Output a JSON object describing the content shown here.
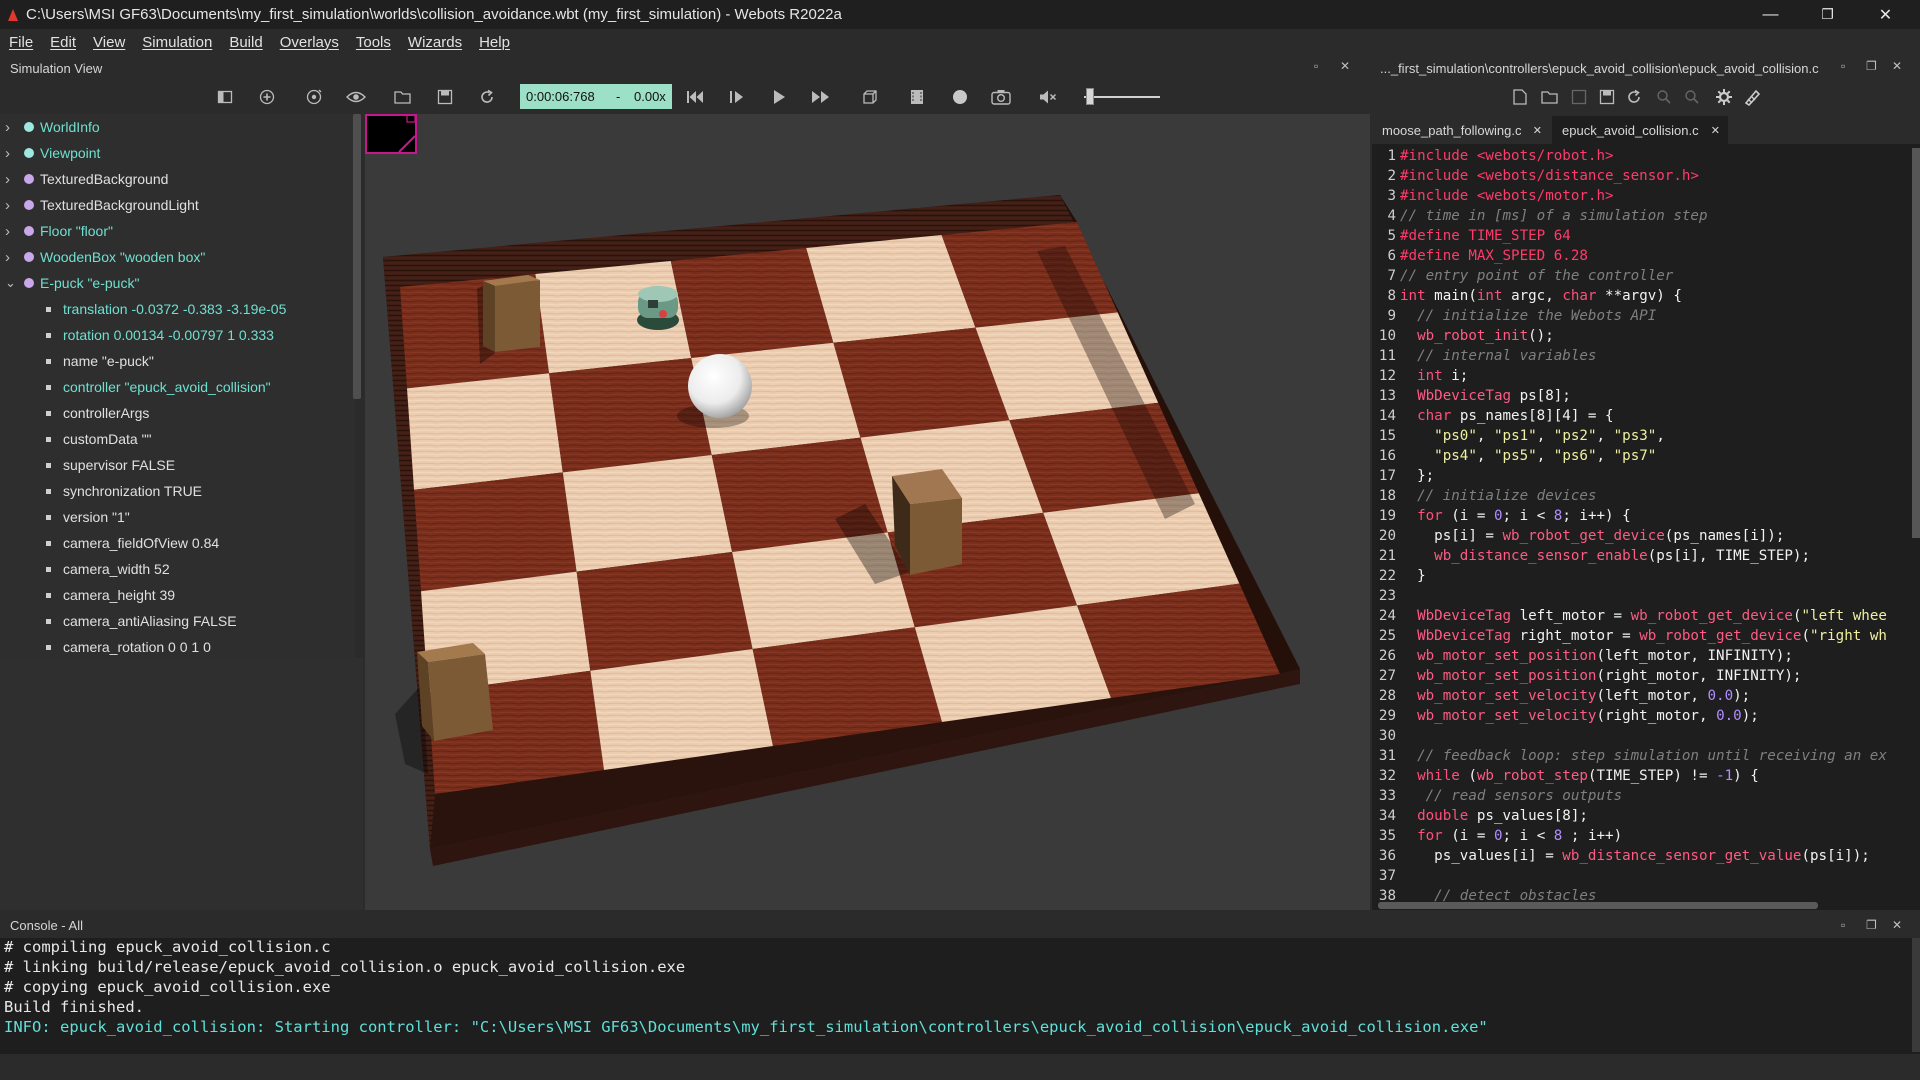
{
  "window": {
    "title": "C:\\Users\\MSI GF63\\Documents\\my_first_simulation\\worlds\\collision_avoidance.wbt (my_first_simulation) - Webots R2022a",
    "min": "—",
    "max": "❐",
    "close": "✕"
  },
  "menu": [
    "File",
    "Edit",
    "View",
    "Simulation",
    "Build",
    "Overlays",
    "Tools",
    "Wizards",
    "Help"
  ],
  "simview": {
    "title": "Simulation View",
    "float": "▫",
    "close": "✕"
  },
  "toolbar": {
    "time": "0:00:06:768",
    "dash": "-",
    "speed": "0.00x"
  },
  "tree": [
    {
      "label": "WorldInfo",
      "color": "#6fe0d0",
      "dot": "#9ee8e0",
      "level": 0,
      "open": false
    },
    {
      "label": "Viewpoint",
      "color": "#6fe0d0",
      "dot": "#9ee8e0",
      "level": 0,
      "open": false
    },
    {
      "label": "TexturedBackground",
      "color": "#e0e0e0",
      "dot": "#c8a8e8",
      "level": 0,
      "open": false
    },
    {
      "label": "TexturedBackgroundLight",
      "color": "#e0e0e0",
      "dot": "#c8a8e8",
      "level": 0,
      "open": false
    },
    {
      "label": "Floor \"floor\"",
      "color": "#6fe0d0",
      "dot": "#c8a8e8",
      "level": 0,
      "open": false
    },
    {
      "label": "WoodenBox \"wooden box\"",
      "color": "#6fe0d0",
      "dot": "#c8a8e8",
      "level": 0,
      "open": false
    },
    {
      "label": "E-puck \"e-puck\"",
      "color": "#6fe0d0",
      "dot": "#c8a8e8",
      "level": 0,
      "open": true
    },
    {
      "label": "translation -0.0372 -0.383 -3.19e-05",
      "color": "#6fe0d0",
      "level": 1
    },
    {
      "label": "rotation 0.00134 -0.00797 1 0.333",
      "color": "#6fe0d0",
      "level": 1
    },
    {
      "label": "name \"e-puck\"",
      "color": "#e0e0e0",
      "level": 1
    },
    {
      "label": "controller \"epuck_avoid_collision\"",
      "color": "#6fe0d0",
      "level": 1
    },
    {
      "label": "controllerArgs",
      "color": "#e0e0e0",
      "level": 1
    },
    {
      "label": "customData \"\"",
      "color": "#e0e0e0",
      "level": 1
    },
    {
      "label": "supervisor FALSE",
      "color": "#e0e0e0",
      "level": 1
    },
    {
      "label": "synchronization TRUE",
      "color": "#e0e0e0",
      "level": 1
    },
    {
      "label": "version \"1\"",
      "color": "#e0e0e0",
      "level": 1
    },
    {
      "label": "camera_fieldOfView 0.84",
      "color": "#e0e0e0",
      "level": 1
    },
    {
      "label": "camera_width 52",
      "color": "#e0e0e0",
      "level": 1
    },
    {
      "label": "camera_height 39",
      "color": "#e0e0e0",
      "level": 1
    },
    {
      "label": "camera_antiAliasing FALSE",
      "color": "#e0e0e0",
      "level": 1
    },
    {
      "label": "camera_rotation 0 0 1 0",
      "color": "#e0e0e0",
      "level": 1
    }
  ],
  "editor": {
    "path": "..._first_simulation\\controllers\\epuck_avoid_collision\\epuck_avoid_collision.c",
    "tabs": [
      {
        "label": "moose_path_following.c",
        "close": "✕",
        "active": false
      },
      {
        "label": "epuck_avoid_collision.c",
        "close": "✕",
        "active": true
      }
    ],
    "lines": [
      {
        "n": "1",
        "t": [
          [
            "pp",
            "#include <webots/robot.h>"
          ]
        ]
      },
      {
        "n": "2",
        "t": [
          [
            "pp",
            "#include <webots/distance_sensor.h>"
          ]
        ]
      },
      {
        "n": "3",
        "t": [
          [
            "pp",
            "#include <webots/motor.h>"
          ]
        ]
      },
      {
        "n": "4",
        "t": [
          [
            "cm",
            "// time in [ms] of a simulation step"
          ]
        ]
      },
      {
        "n": "5",
        "t": [
          [
            "pp",
            "#define TIME_STEP 64"
          ]
        ]
      },
      {
        "n": "6",
        "t": [
          [
            "pp",
            "#define MAX_SPEED 6.28"
          ]
        ]
      },
      {
        "n": "7",
        "t": [
          [
            "cm",
            "// entry point of the controller"
          ]
        ]
      },
      {
        "n": "8",
        "t": [
          [
            "kw",
            "int "
          ],
          [
            "pl",
            "main("
          ],
          [
            "kw",
            "int "
          ],
          [
            "pl",
            "argc, "
          ],
          [
            "kw",
            "char "
          ],
          [
            "pl",
            "**argv) {"
          ]
        ]
      },
      {
        "n": "9",
        "t": [
          [
            "cm",
            "  // initialize the Webots API"
          ]
        ]
      },
      {
        "n": "10",
        "t": [
          [
            "pl",
            "  "
          ],
          [
            "fn",
            "wb_robot_init"
          ],
          [
            "pl",
            "();"
          ]
        ]
      },
      {
        "n": "11",
        "t": [
          [
            "cm",
            "  // internal variables"
          ]
        ]
      },
      {
        "n": "12",
        "t": [
          [
            "pl",
            "  "
          ],
          [
            "kw",
            "int "
          ],
          [
            "pl",
            "i;"
          ]
        ]
      },
      {
        "n": "13",
        "t": [
          [
            "pl",
            "  "
          ],
          [
            "fn",
            "WbDeviceTag "
          ],
          [
            "pl",
            "ps[8];"
          ]
        ]
      },
      {
        "n": "14",
        "t": [
          [
            "pl",
            "  "
          ],
          [
            "kw",
            "char "
          ],
          [
            "pl",
            "ps_names[8][4] = {"
          ]
        ]
      },
      {
        "n": "15",
        "t": [
          [
            "pl",
            "    "
          ],
          [
            "st",
            "\"ps0\""
          ],
          [
            "pl",
            ", "
          ],
          [
            "st",
            "\"ps1\""
          ],
          [
            "pl",
            ", "
          ],
          [
            "st",
            "\"ps2\""
          ],
          [
            "pl",
            ", "
          ],
          [
            "st",
            "\"ps3\""
          ],
          [
            "pl",
            ","
          ]
        ]
      },
      {
        "n": "16",
        "t": [
          [
            "pl",
            "    "
          ],
          [
            "st",
            "\"ps4\""
          ],
          [
            "pl",
            ", "
          ],
          [
            "st",
            "\"ps5\""
          ],
          [
            "pl",
            ", "
          ],
          [
            "st",
            "\"ps6\""
          ],
          [
            "pl",
            ", "
          ],
          [
            "st",
            "\"ps7\""
          ]
        ]
      },
      {
        "n": "17",
        "t": [
          [
            "pl",
            "  };"
          ]
        ]
      },
      {
        "n": "18",
        "t": [
          [
            "cm",
            "  // initialize devices"
          ]
        ]
      },
      {
        "n": "19",
        "t": [
          [
            "pl",
            "  "
          ],
          [
            "kw",
            "for "
          ],
          [
            "pl",
            "(i = "
          ],
          [
            "nm",
            "0"
          ],
          [
            "pl",
            "; i < "
          ],
          [
            "nm",
            "8"
          ],
          [
            "pl",
            "; i++) {"
          ]
        ]
      },
      {
        "n": "20",
        "t": [
          [
            "pl",
            "    ps[i] = "
          ],
          [
            "fn",
            "wb_robot_get_device"
          ],
          [
            "pl",
            "(ps_names[i]);"
          ]
        ]
      },
      {
        "n": "21",
        "t": [
          [
            "pl",
            "    "
          ],
          [
            "fn",
            "wb_distance_sensor_enable"
          ],
          [
            "pl",
            "(ps[i], TIME_STEP);"
          ]
        ]
      },
      {
        "n": "22",
        "t": [
          [
            "pl",
            "  }"
          ]
        ]
      },
      {
        "n": "23",
        "t": [
          [
            "pl",
            ""
          ]
        ]
      },
      {
        "n": "24",
        "t": [
          [
            "pl",
            "  "
          ],
          [
            "fn",
            "WbDeviceTag "
          ],
          [
            "pl",
            "left_motor = "
          ],
          [
            "fn",
            "wb_robot_get_device"
          ],
          [
            "pl",
            "("
          ],
          [
            "st",
            "\"left whee"
          ]
        ]
      },
      {
        "n": "25",
        "t": [
          [
            "pl",
            "  "
          ],
          [
            "fn",
            "WbDeviceTag "
          ],
          [
            "pl",
            "right_motor = "
          ],
          [
            "fn",
            "wb_robot_get_device"
          ],
          [
            "pl",
            "("
          ],
          [
            "st",
            "\"right wh"
          ]
        ]
      },
      {
        "n": "26",
        "t": [
          [
            "pl",
            "  "
          ],
          [
            "fn",
            "wb_motor_set_position"
          ],
          [
            "pl",
            "(left_motor, INFINITY);"
          ]
        ]
      },
      {
        "n": "27",
        "t": [
          [
            "pl",
            "  "
          ],
          [
            "fn",
            "wb_motor_set_position"
          ],
          [
            "pl",
            "(right_motor, INFINITY);"
          ]
        ]
      },
      {
        "n": "28",
        "t": [
          [
            "pl",
            "  "
          ],
          [
            "fn",
            "wb_motor_set_velocity"
          ],
          [
            "pl",
            "(left_motor, "
          ],
          [
            "nm",
            "0.0"
          ],
          [
            "pl",
            ");"
          ]
        ]
      },
      {
        "n": "29",
        "t": [
          [
            "pl",
            "  "
          ],
          [
            "fn",
            "wb_motor_set_velocity"
          ],
          [
            "pl",
            "(right_motor, "
          ],
          [
            "nm",
            "0.0"
          ],
          [
            "pl",
            ");"
          ]
        ]
      },
      {
        "n": "30",
        "t": [
          [
            "pl",
            ""
          ]
        ]
      },
      {
        "n": "31",
        "t": [
          [
            "cm",
            "  // feedback loop: step simulation until receiving an ex"
          ]
        ]
      },
      {
        "n": "32",
        "t": [
          [
            "pl",
            "  "
          ],
          [
            "kw",
            "while "
          ],
          [
            "pl",
            "("
          ],
          [
            "fn",
            "wb_robot_step"
          ],
          [
            "pl",
            "(TIME_STEP) != "
          ],
          [
            "nm",
            "-1"
          ],
          [
            "pl",
            ") {"
          ]
        ]
      },
      {
        "n": "33",
        "t": [
          [
            "cm",
            "   // read sensors outputs"
          ]
        ]
      },
      {
        "n": "34",
        "t": [
          [
            "pl",
            "  "
          ],
          [
            "kw",
            "double "
          ],
          [
            "pl",
            "ps_values[8];"
          ]
        ]
      },
      {
        "n": "35",
        "t": [
          [
            "pl",
            "  "
          ],
          [
            "kw",
            "for "
          ],
          [
            "pl",
            "(i = "
          ],
          [
            "nm",
            "0"
          ],
          [
            "pl",
            "; i < "
          ],
          [
            "nm",
            "8"
          ],
          [
            "pl",
            " ; i++)"
          ]
        ]
      },
      {
        "n": "36",
        "t": [
          [
            "pl",
            "    ps_values[i] = "
          ],
          [
            "fn",
            "wb_distance_sensor_get_value"
          ],
          [
            "pl",
            "(ps[i]);"
          ]
        ]
      },
      {
        "n": "37",
        "t": [
          [
            "pl",
            ""
          ]
        ]
      },
      {
        "n": "38",
        "t": [
          [
            "cm",
            "    // detect obstacles"
          ]
        ]
      }
    ]
  },
  "console": {
    "title": "Console - All",
    "lines": [
      {
        "text": "# compiling epuck_avoid_collision.c",
        "color": "#e8e8e8"
      },
      {
        "text": "# linking build/release/epuck_avoid_collision.o epuck_avoid_collision.exe",
        "color": "#e8e8e8"
      },
      {
        "text": "# copying epuck_avoid_collision.exe",
        "color": "#e8e8e8"
      },
      {
        "text": "Build finished.",
        "color": "#e8e8e8"
      },
      {
        "text": "INFO: epuck_avoid_collision: Starting controller: \"C:\\Users\\MSI GF63\\Documents\\my_first_simulation\\controllers\\epuck_avoid_collision\\epuck_avoid_collision.exe\"",
        "color": "#5fe0d8"
      }
    ]
  },
  "volume_level": 0.08
}
